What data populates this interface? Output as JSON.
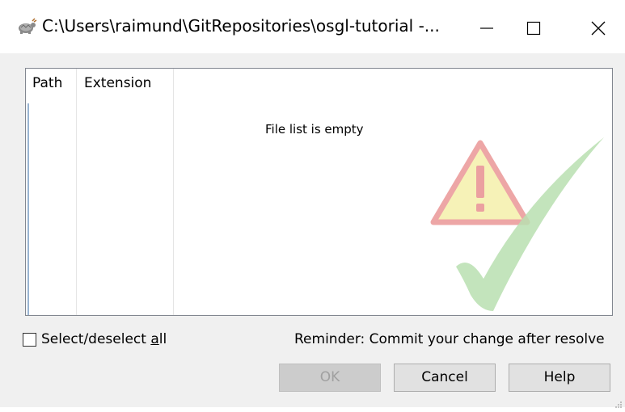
{
  "window": {
    "title": "C:\\Users\\raimund\\GitRepositories\\osgl-tutorial -...",
    "icon": "tortoisegit-icon"
  },
  "controls": {
    "minimize_icon": "minimize-icon",
    "maximize_icon": "maximize-icon",
    "close_icon": "close-icon"
  },
  "list": {
    "columns": [
      "Path",
      "Extension"
    ],
    "empty_message": "File list is empty",
    "watermark_icon": "warning-check-watermark-icon"
  },
  "footer": {
    "select_all_prefix": "Select/deselect ",
    "select_all_accel": "a",
    "select_all_suffix": "ll",
    "select_all_checked": false,
    "reminder": "Reminder: Commit your change after resolve"
  },
  "buttons": {
    "ok": "OK",
    "cancel": "Cancel",
    "help": "Help"
  },
  "colors": {
    "window_bg": "#f0f0f0",
    "list_border": "#828790",
    "disabled_text": "#a0a0a0"
  }
}
